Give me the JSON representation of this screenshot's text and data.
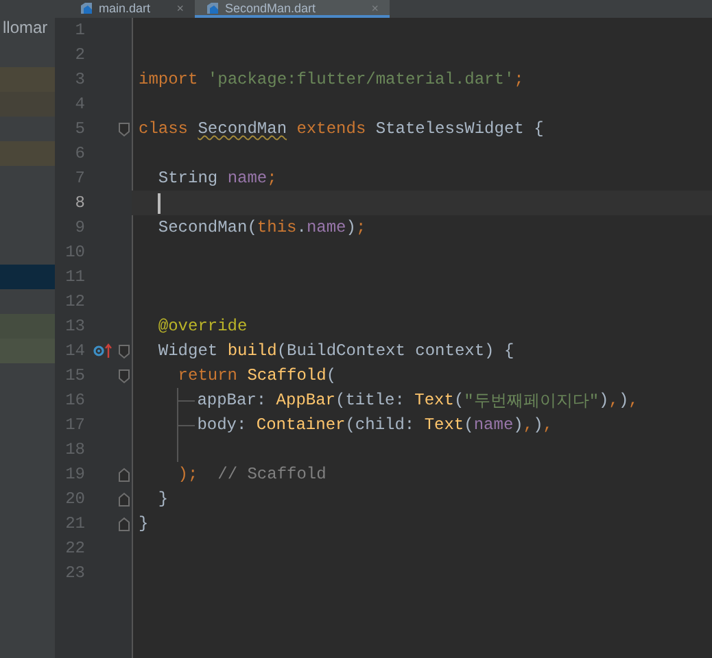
{
  "tabs": [
    {
      "label": "main.dart",
      "close": "×",
      "selected": false
    },
    {
      "label": "SecondMan.dart",
      "close": "×",
      "selected": true
    }
  ],
  "sidebar": {
    "text": "llomar",
    "rows": [
      {
        "kind": "plain"
      },
      {
        "kind": "highlight",
        "color": "#4b4739"
      },
      {
        "kind": "highlight",
        "color": "#454238"
      },
      {
        "kind": "plain"
      },
      {
        "kind": "highlight",
        "color": "#4b4739"
      },
      {
        "kind": "plain"
      },
      {
        "kind": "plain"
      },
      {
        "kind": "plain"
      },
      {
        "kind": "plain"
      },
      {
        "kind": "highlight",
        "color": "#0d293e"
      },
      {
        "kind": "plain"
      },
      {
        "kind": "highlight",
        "color": "#454d40"
      },
      {
        "kind": "highlight",
        "color": "#4a5244"
      }
    ]
  },
  "lines": [
    {
      "number": "1"
    },
    {
      "number": "2"
    },
    {
      "number": "3",
      "tokens": [
        {
          "kind": "keyword",
          "text": "import "
        },
        {
          "kind": "string",
          "text": "'package:flutter/material.dart'"
        },
        {
          "kind": "punct",
          "text": ";"
        }
      ]
    },
    {
      "number": "4"
    },
    {
      "number": "5",
      "gutter_icons": [
        {
          "kind": "fold-start"
        }
      ],
      "tokens": [
        {
          "kind": "keyword",
          "text": "class "
        },
        {
          "kind": "plain",
          "text": "SecondMan",
          "warn": true
        },
        {
          "kind": "keyword",
          "text": " extends "
        },
        {
          "kind": "plain",
          "text": "StatelessWidget {"
        }
      ]
    },
    {
      "number": "6"
    },
    {
      "number": "7",
      "tokens": [
        {
          "kind": "plain",
          "text": "  String "
        },
        {
          "kind": "field",
          "text": "name"
        },
        {
          "kind": "punct",
          "text": ";"
        }
      ]
    },
    {
      "number": "8",
      "current": true,
      "caret": true
    },
    {
      "number": "9",
      "tokens": [
        {
          "kind": "plain",
          "text": "  SecondMan("
        },
        {
          "kind": "keyword",
          "text": "this"
        },
        {
          "kind": "plain",
          "text": "."
        },
        {
          "kind": "field",
          "text": "name"
        },
        {
          "kind": "plain",
          "text": ")"
        },
        {
          "kind": "punct",
          "text": ";"
        }
      ]
    },
    {
      "number": "10"
    },
    {
      "number": "11"
    },
    {
      "number": "12"
    },
    {
      "number": "13",
      "tokens": [
        {
          "kind": "annotation",
          "text": "  @override"
        }
      ]
    },
    {
      "number": "14",
      "gutter_icons": [
        {
          "kind": "override"
        },
        {
          "kind": "fold-start"
        }
      ],
      "tokens": [
        {
          "kind": "plain",
          "text": "  Widget "
        },
        {
          "kind": "method",
          "text": "build"
        },
        {
          "kind": "plain",
          "text": "(BuildContext context) {"
        }
      ]
    },
    {
      "number": "15",
      "gutter_icons": [
        {
          "kind": "fold-start"
        }
      ],
      "tokens": [
        {
          "kind": "keyword",
          "text": "    return "
        },
        {
          "kind": "method",
          "text": "Scaffold"
        },
        {
          "kind": "plain",
          "text": "("
        }
      ]
    },
    {
      "number": "16",
      "tokens": [
        {
          "kind": "guide-branch"
        },
        {
          "kind": "plain",
          "text": "appBar: "
        },
        {
          "kind": "method",
          "text": "AppBar"
        },
        {
          "kind": "plain",
          "text": "(title: "
        },
        {
          "kind": "method",
          "text": "Text"
        },
        {
          "kind": "plain",
          "text": "("
        },
        {
          "kind": "string",
          "text": "\"두번째페이지다\""
        },
        {
          "kind": "plain",
          "text": ")"
        },
        {
          "kind": "punct",
          "text": ","
        },
        {
          "kind": "plain",
          "text": ")"
        },
        {
          "kind": "punct",
          "text": ","
        }
      ]
    },
    {
      "number": "17",
      "tokens": [
        {
          "kind": "guide-branch"
        },
        {
          "kind": "plain",
          "text": "body: "
        },
        {
          "kind": "method",
          "text": "Container"
        },
        {
          "kind": "plain",
          "text": "(child: "
        },
        {
          "kind": "method",
          "text": "Text"
        },
        {
          "kind": "plain",
          "text": "("
        },
        {
          "kind": "field",
          "text": "name"
        },
        {
          "kind": "plain",
          "text": ")"
        },
        {
          "kind": "punct",
          "text": ","
        },
        {
          "kind": "plain",
          "text": ")"
        },
        {
          "kind": "punct",
          "text": ","
        }
      ]
    },
    {
      "number": "18",
      "tokens": [
        {
          "kind": "guide-line"
        }
      ]
    },
    {
      "number": "19",
      "gutter_icons": [
        {
          "kind": "fold-end"
        }
      ],
      "tokens": [
        {
          "kind": "punct",
          "text": "    );"
        },
        {
          "kind": "comment",
          "text": "  // Scaffold"
        }
      ]
    },
    {
      "number": "20",
      "gutter_icons": [
        {
          "kind": "fold-end"
        }
      ],
      "tokens": [
        {
          "kind": "plain",
          "text": "  }"
        }
      ]
    },
    {
      "number": "21",
      "gutter_icons": [
        {
          "kind": "fold-end"
        }
      ],
      "tokens": [
        {
          "kind": "plain",
          "text": "}"
        }
      ]
    },
    {
      "number": "22"
    },
    {
      "number": "23"
    }
  ]
}
